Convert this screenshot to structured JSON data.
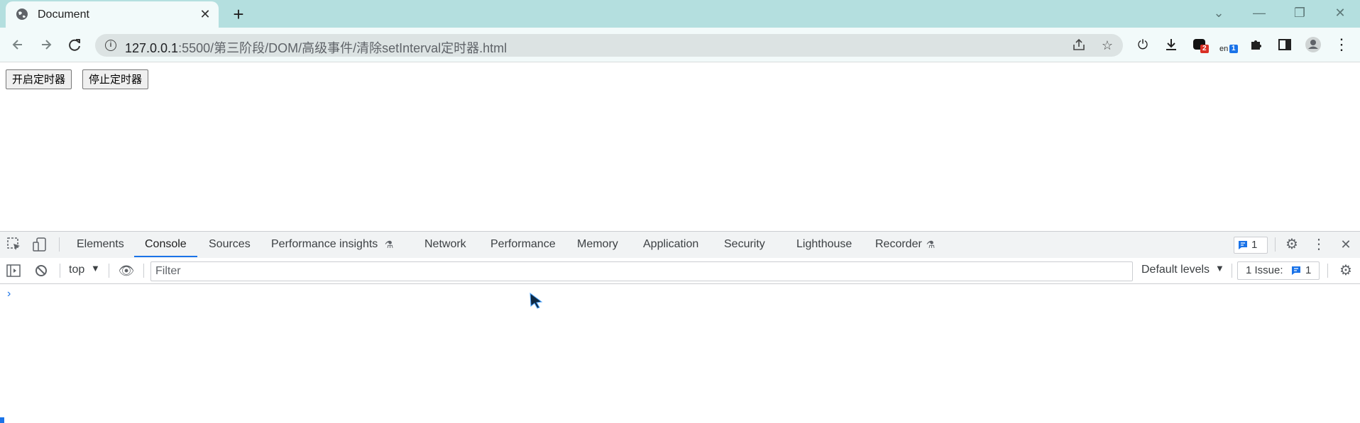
{
  "browser": {
    "tab": {
      "title": "Document",
      "close_glyph": "✕"
    },
    "new_tab_glyph": "+",
    "window_controls": {
      "dropdown": "⌄",
      "minimize": "—",
      "restore": "❐",
      "close": "✕"
    },
    "url": {
      "host": "127.0.0.1",
      "path": ":5500/第三阶段/DOM/高级事件/清除setInterval定时器.html"
    },
    "extension_badges": {
      "ext1": "2",
      "ext2": "1",
      "ext2_text": "en"
    }
  },
  "page": {
    "buttons": {
      "start": "开启定时器",
      "stop": "停止定时器"
    }
  },
  "devtools": {
    "tabs": [
      "Elements",
      "Console",
      "Sources",
      "Performance insights",
      "Network",
      "Performance",
      "Memory",
      "Application",
      "Security",
      "Lighthouse",
      "Recorder"
    ],
    "active_tab": "Console",
    "issues_count": "1",
    "console": {
      "context": "top",
      "filter_placeholder": "Filter",
      "levels": "Default levels",
      "issues_label": "1 Issue:",
      "issues_num": "1",
      "prompt": "›"
    }
  },
  "colors": {
    "tabstrip": "#b4dfdf",
    "toolbar": "#f2fafa",
    "accent": "#1a73e8"
  }
}
